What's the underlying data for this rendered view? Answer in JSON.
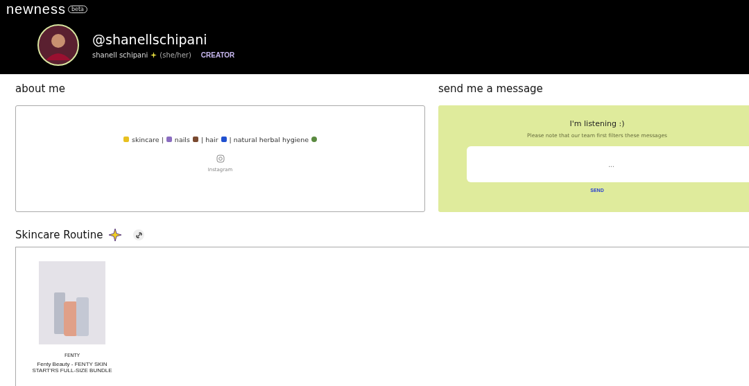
{
  "header": {
    "logo": "newness",
    "badge": "beta",
    "username": "@shanellschipani",
    "display_name": "shanell schipani",
    "pronouns": "(she/her)",
    "role": "CREATOR"
  },
  "about": {
    "title": "about me",
    "bio_parts": [
      "skincare |",
      "nails",
      "| hair",
      "| natural herbal hygiene"
    ],
    "social_label": "Instagram"
  },
  "message": {
    "title": "send me a message",
    "heading": "I'm listening :)",
    "note": "Please note that our team first filters these messages",
    "placeholder": "...",
    "send_label": "SEND"
  },
  "collection": {
    "title": "Skincare Routine",
    "products": [
      {
        "brand": "FENTY",
        "name": "Fenty Beauty - FENTY SKIN START'RS FULL-SIZE BUNDLE"
      }
    ]
  }
}
